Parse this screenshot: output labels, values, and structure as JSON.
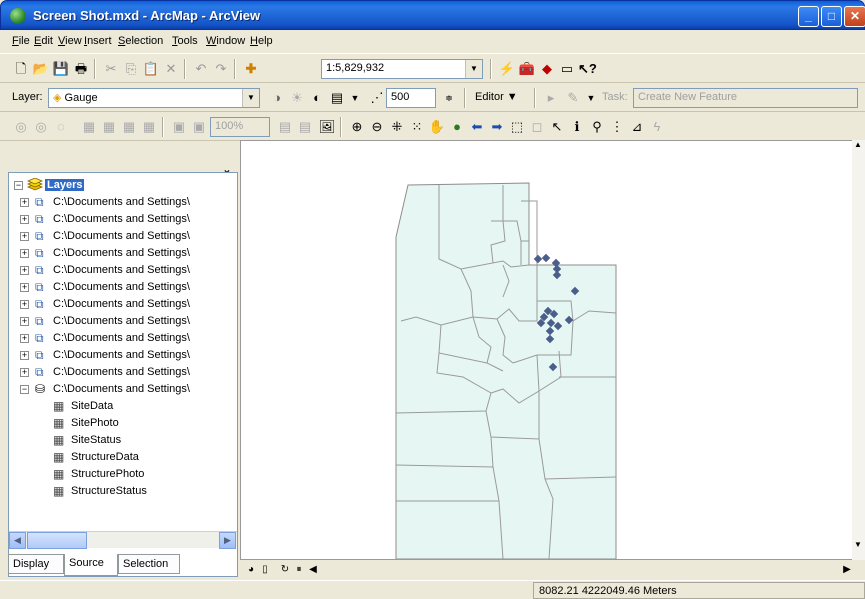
{
  "window": {
    "title": "Screen Shot.mxd - ArcMap - ArcView"
  },
  "menu": [
    "File",
    "Edit",
    "View",
    "Insert",
    "Selection",
    "Tools",
    "Window",
    "Help"
  ],
  "standard_toolbar": {
    "scale": "1:5,829,932"
  },
  "label_toolbar": {
    "layer_label": "Layer:",
    "layer_value": "Gauge",
    "snap_value": "500"
  },
  "editor_toolbar": {
    "editor_label": "Editor",
    "task_label": "Task:",
    "task_value": "Create New Feature"
  },
  "tools_toolbar": {
    "zoom_value": "100%"
  },
  "toc": {
    "root": "Layers",
    "layers": [
      "C:\\Documents and Settings\\",
      "C:\\Documents and Settings\\",
      "C:\\Documents and Settings\\",
      "C:\\Documents and Settings\\",
      "C:\\Documents and Settings\\",
      "C:\\Documents and Settings\\",
      "C:\\Documents and Settings\\",
      "C:\\Documents and Settings\\",
      "C:\\Documents and Settings\\",
      "C:\\Documents and Settings\\",
      "C:\\Documents and Settings\\"
    ],
    "database": "C:\\Documents and Settings\\",
    "tables": [
      "SiteData",
      "SitePhoto",
      "SiteStatus",
      "StructureData",
      "StructurePhoto",
      "StructureStatus"
    ],
    "tabs": [
      "Display",
      "Source",
      "Selection"
    ],
    "active_tab": "Source"
  },
  "map": {
    "fill_color": "#e6f7f3",
    "outline_color": "#8c8c8c",
    "point_color": "#4a5e8c"
  },
  "status": {
    "coordinates": "8082.21  4222049.46 Meters"
  }
}
